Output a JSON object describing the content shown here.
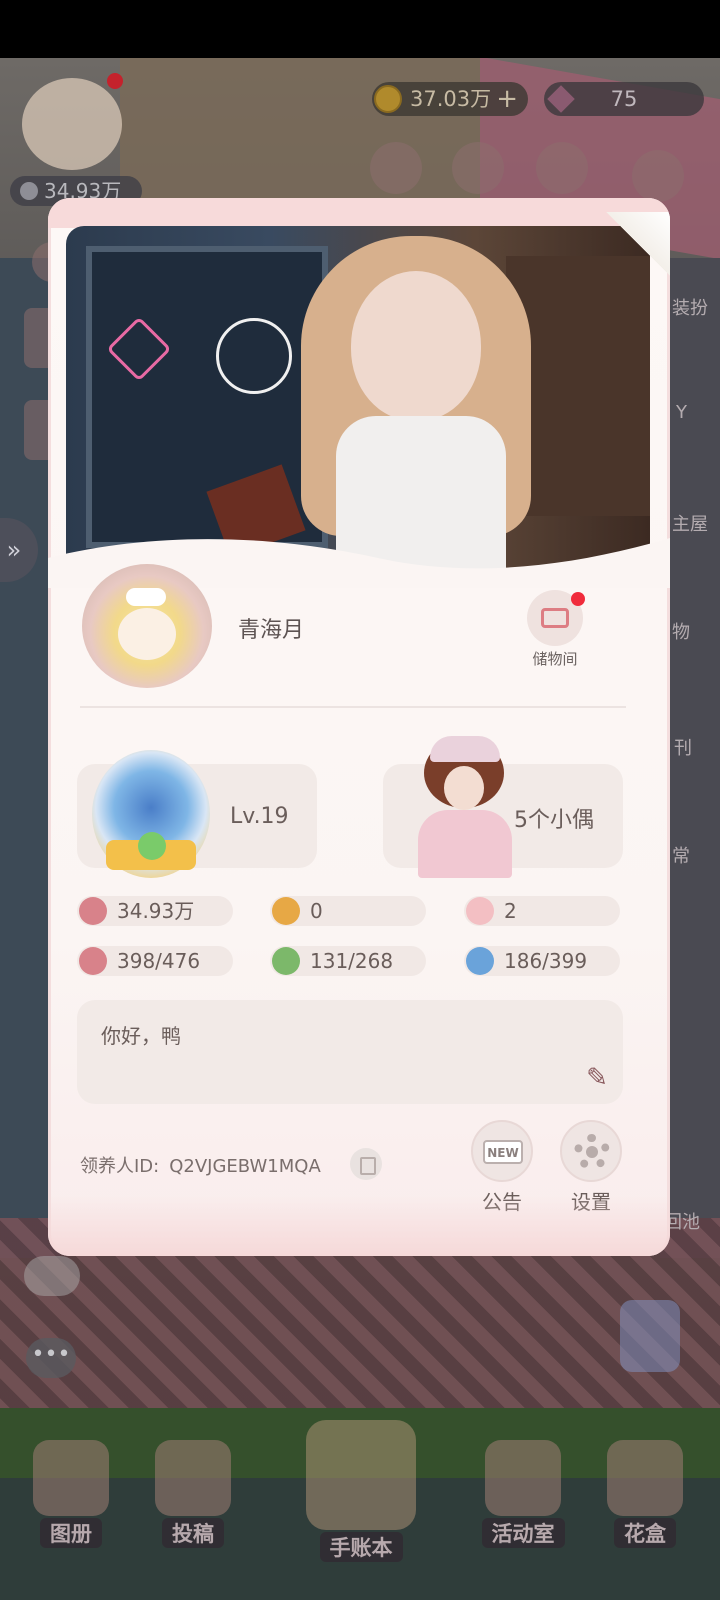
{
  "hud": {
    "fans": "34.93万",
    "coins": "37.03万",
    "coins_plus": "+",
    "gems": "75"
  },
  "side_labels": [
    "装扮",
    "Y",
    "主屋",
    "物",
    "刊",
    "常",
    "回池"
  ],
  "bottom_nav": [
    {
      "label": "图册"
    },
    {
      "label": "投稿"
    },
    {
      "label": "手账本"
    },
    {
      "label": "活动室"
    },
    {
      "label": "花盒"
    }
  ],
  "profile": {
    "nickname": "青海月",
    "storage_label": "储物间",
    "level": "Lv.19",
    "dolls": "5个小偶",
    "stats": [
      {
        "icon": "fans-icon",
        "value": "34.93万"
      },
      {
        "icon": "footprint-icon",
        "value": "0"
      },
      {
        "icon": "heart-icon",
        "value": "2"
      },
      {
        "icon": "dress-icon",
        "value": "398/476"
      },
      {
        "icon": "furniture-icon",
        "value": "131/268"
      },
      {
        "icon": "bag-icon",
        "value": "186/399"
      }
    ],
    "signature": "你好，鸭",
    "adopter_label": "领养人ID:",
    "adopter_id": "Q2VJGEBW1MQA",
    "announcement_label": "公告",
    "announcement_tag": "NEW",
    "settings_label": "设置"
  },
  "colors": {
    "card_bg": "#fbf5f3",
    "panel_bg": "#f2eae7",
    "notify_red": "#f02b3b",
    "text_main": "#6a5d5a"
  }
}
